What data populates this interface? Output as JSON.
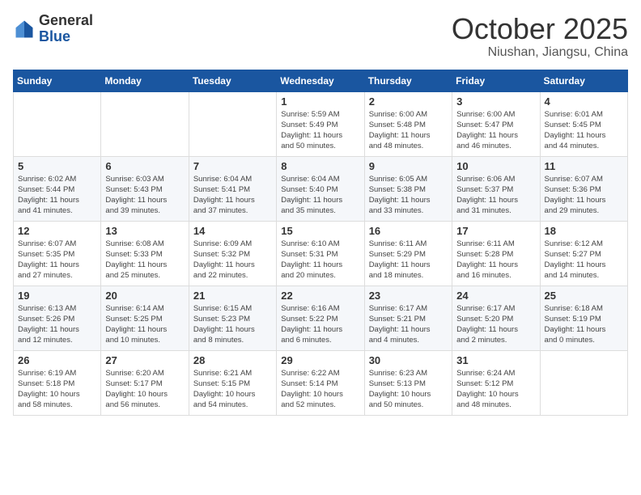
{
  "header": {
    "logo": {
      "general": "General",
      "blue": "Blue"
    },
    "month": "October 2025",
    "location": "Niushan, Jiangsu, China"
  },
  "days_of_week": [
    "Sunday",
    "Monday",
    "Tuesday",
    "Wednesday",
    "Thursday",
    "Friday",
    "Saturday"
  ],
  "weeks": [
    [
      {
        "day": "",
        "detail": ""
      },
      {
        "day": "",
        "detail": ""
      },
      {
        "day": "",
        "detail": ""
      },
      {
        "day": "1",
        "detail": "Sunrise: 5:59 AM\nSunset: 5:49 PM\nDaylight: 11 hours\nand 50 minutes."
      },
      {
        "day": "2",
        "detail": "Sunrise: 6:00 AM\nSunset: 5:48 PM\nDaylight: 11 hours\nand 48 minutes."
      },
      {
        "day": "3",
        "detail": "Sunrise: 6:00 AM\nSunset: 5:47 PM\nDaylight: 11 hours\nand 46 minutes."
      },
      {
        "day": "4",
        "detail": "Sunrise: 6:01 AM\nSunset: 5:45 PM\nDaylight: 11 hours\nand 44 minutes."
      }
    ],
    [
      {
        "day": "5",
        "detail": "Sunrise: 6:02 AM\nSunset: 5:44 PM\nDaylight: 11 hours\nand 41 minutes."
      },
      {
        "day": "6",
        "detail": "Sunrise: 6:03 AM\nSunset: 5:43 PM\nDaylight: 11 hours\nand 39 minutes."
      },
      {
        "day": "7",
        "detail": "Sunrise: 6:04 AM\nSunset: 5:41 PM\nDaylight: 11 hours\nand 37 minutes."
      },
      {
        "day": "8",
        "detail": "Sunrise: 6:04 AM\nSunset: 5:40 PM\nDaylight: 11 hours\nand 35 minutes."
      },
      {
        "day": "9",
        "detail": "Sunrise: 6:05 AM\nSunset: 5:38 PM\nDaylight: 11 hours\nand 33 minutes."
      },
      {
        "day": "10",
        "detail": "Sunrise: 6:06 AM\nSunset: 5:37 PM\nDaylight: 11 hours\nand 31 minutes."
      },
      {
        "day": "11",
        "detail": "Sunrise: 6:07 AM\nSunset: 5:36 PM\nDaylight: 11 hours\nand 29 minutes."
      }
    ],
    [
      {
        "day": "12",
        "detail": "Sunrise: 6:07 AM\nSunset: 5:35 PM\nDaylight: 11 hours\nand 27 minutes."
      },
      {
        "day": "13",
        "detail": "Sunrise: 6:08 AM\nSunset: 5:33 PM\nDaylight: 11 hours\nand 25 minutes."
      },
      {
        "day": "14",
        "detail": "Sunrise: 6:09 AM\nSunset: 5:32 PM\nDaylight: 11 hours\nand 22 minutes."
      },
      {
        "day": "15",
        "detail": "Sunrise: 6:10 AM\nSunset: 5:31 PM\nDaylight: 11 hours\nand 20 minutes."
      },
      {
        "day": "16",
        "detail": "Sunrise: 6:11 AM\nSunset: 5:29 PM\nDaylight: 11 hours\nand 18 minutes."
      },
      {
        "day": "17",
        "detail": "Sunrise: 6:11 AM\nSunset: 5:28 PM\nDaylight: 11 hours\nand 16 minutes."
      },
      {
        "day": "18",
        "detail": "Sunrise: 6:12 AM\nSunset: 5:27 PM\nDaylight: 11 hours\nand 14 minutes."
      }
    ],
    [
      {
        "day": "19",
        "detail": "Sunrise: 6:13 AM\nSunset: 5:26 PM\nDaylight: 11 hours\nand 12 minutes."
      },
      {
        "day": "20",
        "detail": "Sunrise: 6:14 AM\nSunset: 5:25 PM\nDaylight: 11 hours\nand 10 minutes."
      },
      {
        "day": "21",
        "detail": "Sunrise: 6:15 AM\nSunset: 5:23 PM\nDaylight: 11 hours\nand 8 minutes."
      },
      {
        "day": "22",
        "detail": "Sunrise: 6:16 AM\nSunset: 5:22 PM\nDaylight: 11 hours\nand 6 minutes."
      },
      {
        "day": "23",
        "detail": "Sunrise: 6:17 AM\nSunset: 5:21 PM\nDaylight: 11 hours\nand 4 minutes."
      },
      {
        "day": "24",
        "detail": "Sunrise: 6:17 AM\nSunset: 5:20 PM\nDaylight: 11 hours\nand 2 minutes."
      },
      {
        "day": "25",
        "detail": "Sunrise: 6:18 AM\nSunset: 5:19 PM\nDaylight: 11 hours\nand 0 minutes."
      }
    ],
    [
      {
        "day": "26",
        "detail": "Sunrise: 6:19 AM\nSunset: 5:18 PM\nDaylight: 10 hours\nand 58 minutes."
      },
      {
        "day": "27",
        "detail": "Sunrise: 6:20 AM\nSunset: 5:17 PM\nDaylight: 10 hours\nand 56 minutes."
      },
      {
        "day": "28",
        "detail": "Sunrise: 6:21 AM\nSunset: 5:15 PM\nDaylight: 10 hours\nand 54 minutes."
      },
      {
        "day": "29",
        "detail": "Sunrise: 6:22 AM\nSunset: 5:14 PM\nDaylight: 10 hours\nand 52 minutes."
      },
      {
        "day": "30",
        "detail": "Sunrise: 6:23 AM\nSunset: 5:13 PM\nDaylight: 10 hours\nand 50 minutes."
      },
      {
        "day": "31",
        "detail": "Sunrise: 6:24 AM\nSunset: 5:12 PM\nDaylight: 10 hours\nand 48 minutes."
      },
      {
        "day": "",
        "detail": ""
      }
    ]
  ]
}
